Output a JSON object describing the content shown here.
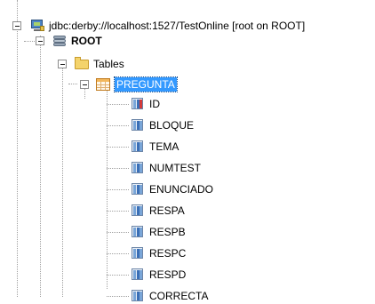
{
  "connection": {
    "label": "jdbc:derby://localhost:1527/TestOnline [root on ROOT]",
    "icon": "database-connection-icon"
  },
  "schema": {
    "label": "ROOT",
    "icon": "schema-icon"
  },
  "folder": {
    "label": "Tables",
    "icon": "folder-icon"
  },
  "table": {
    "label": "PREGUNTA",
    "icon": "table-icon",
    "selected": true
  },
  "columns": [
    {
      "label": "ID",
      "icon": "primary-key-column-icon"
    },
    {
      "label": "BLOQUE",
      "icon": "column-icon"
    },
    {
      "label": "TEMA",
      "icon": "column-icon"
    },
    {
      "label": "NUMTEST",
      "icon": "column-icon"
    },
    {
      "label": "ENUNCIADO",
      "icon": "column-icon"
    },
    {
      "label": "RESPA",
      "icon": "column-icon"
    },
    {
      "label": "RESPB",
      "icon": "column-icon"
    },
    {
      "label": "RESPC",
      "icon": "column-icon"
    },
    {
      "label": "RESPD",
      "icon": "column-icon"
    },
    {
      "label": "CORRECTA",
      "icon": "column-icon"
    }
  ]
}
